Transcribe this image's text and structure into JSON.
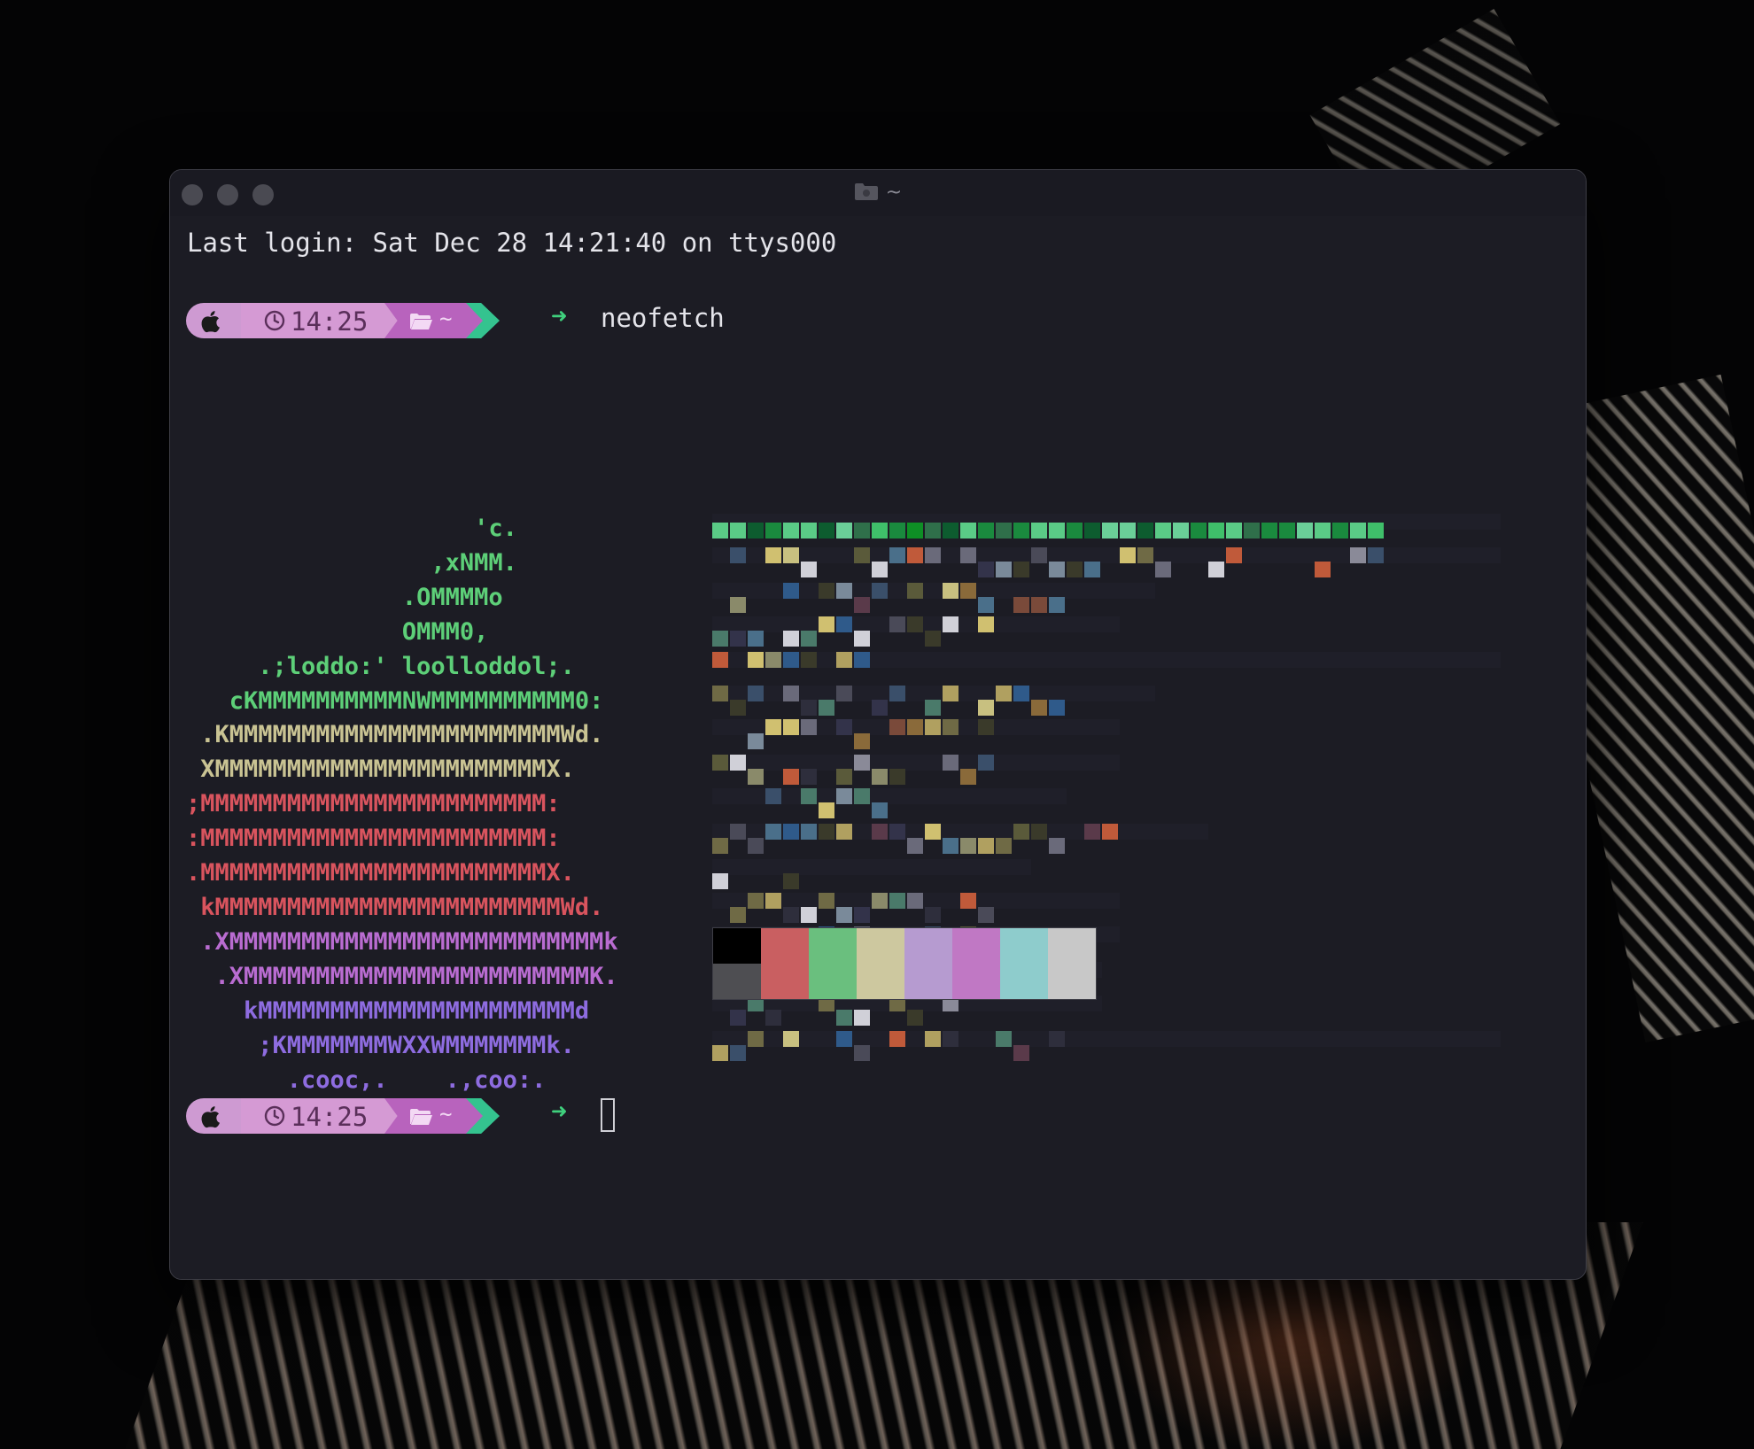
{
  "window": {
    "title": "~",
    "title_icon": "folder-icon"
  },
  "terminal": {
    "last_login": "Last login: Sat Dec 28 14:21:40 on ttys000",
    "prompts": [
      {
        "time": "14:25",
        "dir": "~",
        "arrow": "➜",
        "command": "neofetch"
      },
      {
        "time": "14:25",
        "dir": "~",
        "arrow": "➜",
        "command": ""
      }
    ],
    "ascii_art": [
      {
        "text": "                    'c.",
        "color": "green"
      },
      {
        "text": "                 ,xNMM.",
        "color": "green"
      },
      {
        "text": "               .OMMMMo",
        "color": "green"
      },
      {
        "text": "               OMMM0,",
        "color": "green"
      },
      {
        "text": "     .;loddo:' loolloddol;.",
        "color": "green"
      },
      {
        "text": "   cKMMMMMMMMMMNWMMMMMMMMMM0:",
        "color": "green"
      },
      {
        "text": " .KMMMMMMMMMMMMMMMMMMMMMMMWd.",
        "color": "yellow"
      },
      {
        "text": " XMMMMMMMMMMMMMMMMMMMMMMMX.",
        "color": "yellow"
      },
      {
        "text": ";MMMMMMMMMMMMMMMMMMMMMMMM:",
        "color": "red"
      },
      {
        "text": ":MMMMMMMMMMMMMMMMMMMMMMMM:",
        "color": "red"
      },
      {
        "text": ".MMMMMMMMMMMMMMMMMMMMMMMMX.",
        "color": "red"
      },
      {
        "text": " kMMMMMMMMMMMMMMMMMMMMMMMMWd.",
        "color": "red"
      },
      {
        "text": " .XMMMMMMMMMMMMMMMMMMMMMMMMMMk",
        "color": "purple"
      },
      {
        "text": "  .XMMMMMMMMMMMMMMMMMMMMMMMMK.",
        "color": "purple"
      },
      {
        "text": "    kMMMMMMMMMMMMMMMMMMMMMMd",
        "color": "blue"
      },
      {
        "text": "     ;KMMMMMMMWXXWMMMMMMMk.",
        "color": "blue"
      },
      {
        "text": "       .cooc,.    .,coo:.",
        "color": "blue"
      }
    ],
    "system_info_blurred": true
  },
  "palette": {
    "top_row": [
      "#000000",
      "#c95f61",
      "#6abf7e",
      "#cdc89f",
      "#b69bd0",
      "#c078c4",
      "#8ecccc",
      "#c8c8c8"
    ],
    "bottom_row": [
      "#4e4e52",
      "#c95f61",
      "#6abf7e",
      "#cdc89f",
      "#b69bd0",
      "#c078c4",
      "#8ecccc",
      "#c8c8c8"
    ]
  },
  "colors": {
    "ascii_green": "#5dcf78",
    "ascii_yellow": "#c9c393",
    "ascii_red": "#d9545e",
    "ascii_purple": "#b96cd1",
    "ascii_blue": "#8e6ce0",
    "prompt_arrow": "#3fd07d",
    "terminal_bg": "#1c1c24"
  }
}
